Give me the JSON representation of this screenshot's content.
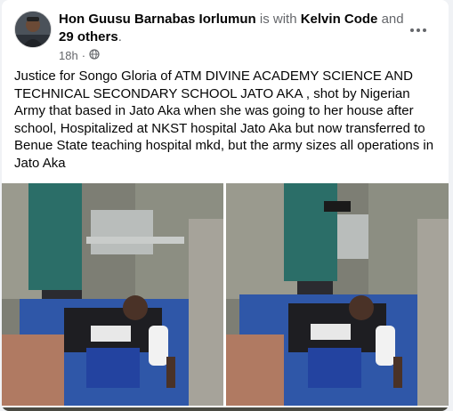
{
  "post": {
    "author": "Hon Guusu Barnabas Iorlumun",
    "with_connector": "is with",
    "tagged_person": "Kelvin Code",
    "and_word": "and",
    "others": "29 others",
    "period": ".",
    "timestamp": "18h",
    "privacy_icon": "globe-icon",
    "more_icon": "more-options-icon",
    "text": "Justice for Songo Gloria of ATM DIVINE ACADEMY SCIENCE AND TECHNICAL SECONDARY SCHOOL JATO AKA , shot by Nigerian Army that based in Jato Aka when she was going to her house after school,  Hospitalized at NKST hospital Jato Aka but now transferred to Benue State teaching hospital mkd, but the army sizes all operations in Jato Aka"
  },
  "colors": {
    "card_bg": "#ffffff",
    "page_bg": "#f0f2f5",
    "primary_text": "#050505",
    "secondary_text": "#65676b",
    "bed_blue": "#2f57a8",
    "wall": "#8a8a80"
  }
}
